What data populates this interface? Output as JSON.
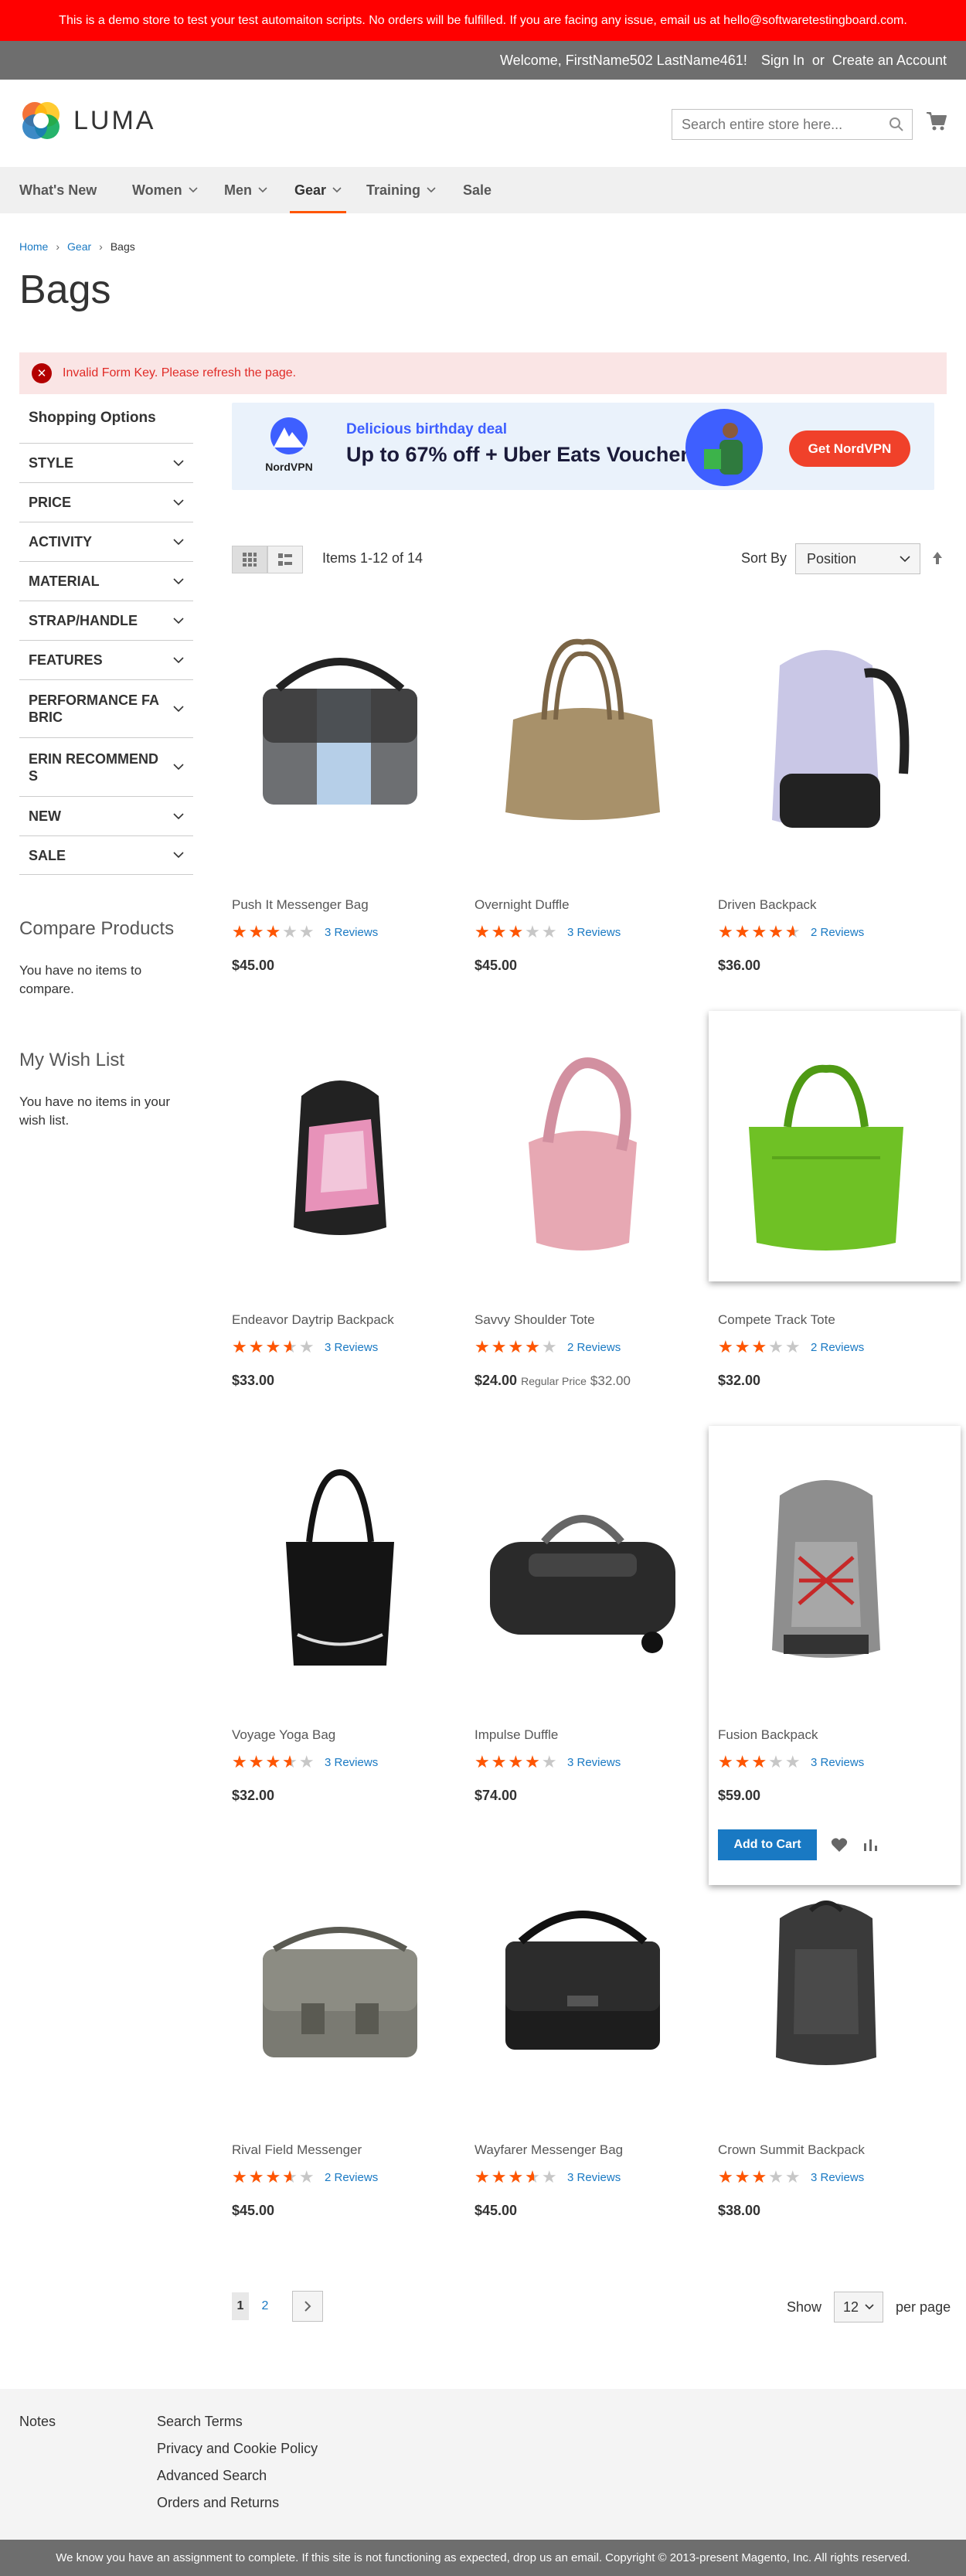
{
  "demo_notice": "This is a demo store to test your test automaiton scripts. No orders will be fulfilled. If you are facing any issue, email us at hello@softwaretestingboard.com.",
  "header_panel": {
    "welcome": "Welcome, FirstName502 LastName461!",
    "sign_in": "Sign In",
    "or": "or",
    "create_account": "Create an Account"
  },
  "logo": {
    "text": "LUMA",
    "icon": "luma-logo-icon"
  },
  "search": {
    "placeholder": "Search entire store here...",
    "icon": "search-icon"
  },
  "cart": {
    "icon": "cart-icon"
  },
  "nav": [
    {
      "label": "What's New",
      "has_submenu": false
    },
    {
      "label": "Women",
      "has_submenu": true
    },
    {
      "label": "Men",
      "has_submenu": true
    },
    {
      "label": "Gear",
      "has_submenu": true,
      "active": true
    },
    {
      "label": "Training",
      "has_submenu": true
    },
    {
      "label": "Sale",
      "has_submenu": false
    }
  ],
  "breadcrumb": [
    "Home",
    "Gear",
    "Bags"
  ],
  "page_title": "Bags",
  "error_message": "Invalid Form Key. Please refresh the page.",
  "sidebar": {
    "title": "Shopping Options",
    "filters": [
      "Style",
      "Price",
      "Activity",
      "Material",
      "Strap/Handle",
      "Features",
      "Performance Fa bric",
      "Erin Recommend s",
      "New",
      "Sale"
    ],
    "compare": {
      "title": "Compare Products",
      "text": "You have no items to compare."
    },
    "wishlist": {
      "title": "My Wish List",
      "text": "You have no items in your wish list."
    }
  },
  "ad": {
    "brand": "NordVPN",
    "headline": "Delicious birthday deal",
    "offer": "Up to 67% off + Uber Eats Voucher",
    "button": "Get NordVPN",
    "accent_color": "#3e5fff",
    "button_color": "#f0412a"
  },
  "toolbar": {
    "modes": [
      "grid",
      "list"
    ],
    "active_mode": "grid",
    "amount": "Items 1-12 of 14",
    "sort_label": "Sort By",
    "sort_value": "Position"
  },
  "products": [
    {
      "name": "Push It Messenger Bag",
      "rating": 0.6,
      "reviews": "3 Reviews",
      "price": "$45.00"
    },
    {
      "name": "Overnight Duffle",
      "rating": 0.6,
      "reviews": "3 Reviews",
      "price": "$45.00"
    },
    {
      "name": "Driven Backpack",
      "rating": 0.9,
      "reviews": "2 Reviews",
      "price": "$36.00"
    },
    {
      "name": "Endeavor Daytrip Backpack",
      "rating": 0.7,
      "reviews": "3 Reviews",
      "price": "$33.00"
    },
    {
      "name": "Savvy Shoulder Tote",
      "rating": 0.8,
      "reviews": "2 Reviews",
      "price": "$24.00",
      "regular_label": "Regular Price",
      "regular_price": "$32.00"
    },
    {
      "name": "Compete Track Tote",
      "rating": 0.6,
      "reviews": "2 Reviews",
      "price": "$32.00",
      "hovered": true
    },
    {
      "name": "Voyage Yoga Bag",
      "rating": 0.7,
      "reviews": "3 Reviews",
      "price": "$32.00"
    },
    {
      "name": "Impulse Duffle",
      "rating": 0.8,
      "reviews": "3 Reviews",
      "price": "$74.00"
    },
    {
      "name": "Fusion Backpack",
      "rating": 0.6,
      "reviews": "3 Reviews",
      "price": "$59.00",
      "hovered": true,
      "show_actions": true
    },
    {
      "name": "Rival Field Messenger",
      "rating": 0.7,
      "reviews": "2 Reviews",
      "price": "$45.00"
    },
    {
      "name": "Wayfarer Messenger Bag",
      "rating": 0.7,
      "reviews": "3 Reviews",
      "price": "$45.00"
    },
    {
      "name": "Crown Summit Backpack",
      "rating": 0.6,
      "reviews": "3 Reviews",
      "price": "$38.00"
    }
  ],
  "product_actions": {
    "add_to_cart": "Add to Cart"
  },
  "pagination": {
    "pages": [
      "1",
      "2"
    ],
    "current": "1"
  },
  "limiter": {
    "label_before": "Show",
    "value": "12",
    "label_after": "per page"
  },
  "footer": {
    "notes": "Notes",
    "links": [
      "Search Terms",
      "Privacy and Cookie Policy",
      "Advanced Search",
      "Orders and Returns"
    ]
  },
  "copyright": "We know you have an assignment to complete. If this site is not functioning as expected, drop us an email. Copyright © 2013-present Magento, Inc. All rights reserved.",
  "colors": {
    "accent": "#1979c3",
    "star": "#ff5501",
    "banner": "#ff0000",
    "panel": "#6e6e6e"
  }
}
